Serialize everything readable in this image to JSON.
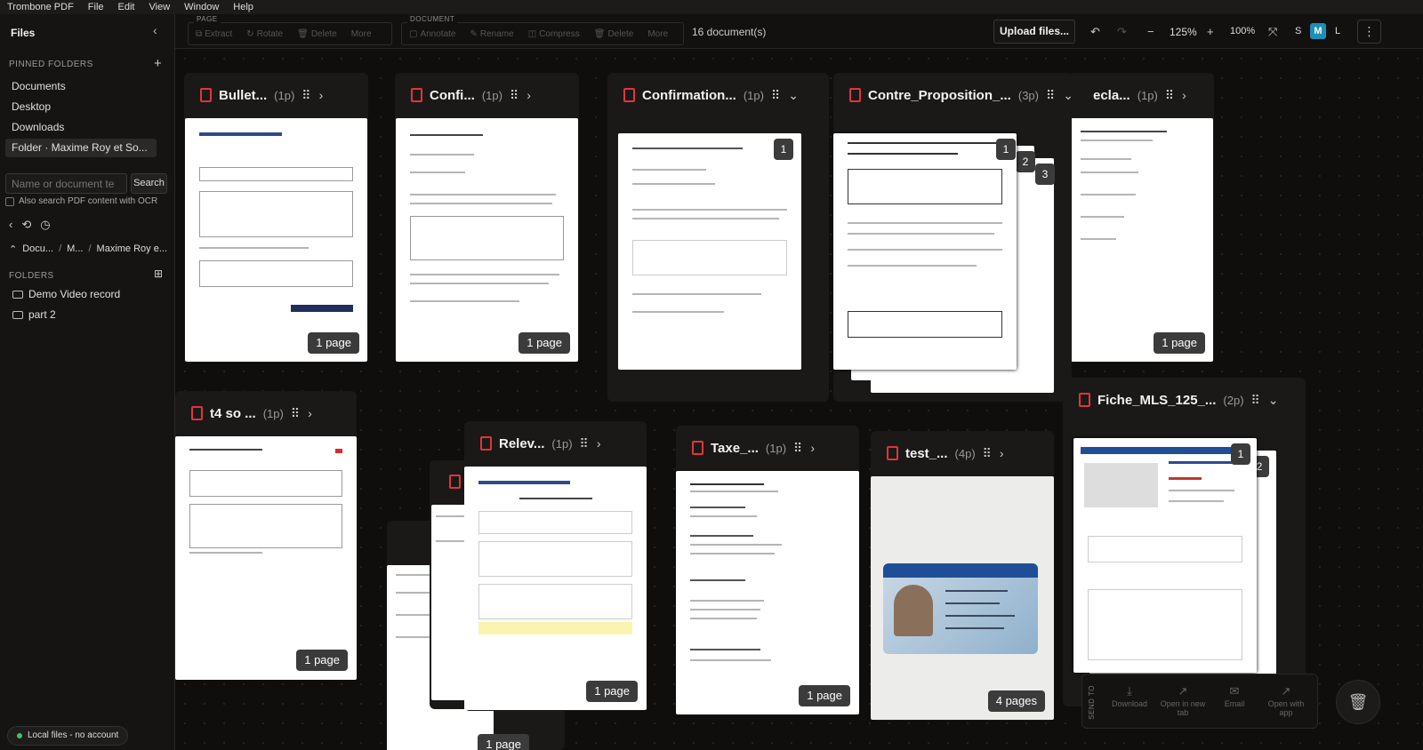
{
  "menubar": {
    "app": "Trombone PDF",
    "items": [
      "File",
      "Edit",
      "View",
      "Window",
      "Help"
    ]
  },
  "sidebar": {
    "title": "Files",
    "pinned_label": "PINNED FOLDERS",
    "pinned": [
      "Documents",
      "Desktop",
      "Downloads",
      "Folder · Maxime Roy et So..."
    ],
    "search_placeholder": "Name or document te",
    "search_button": "Search",
    "ocr_label": "Also search PDF content with OCR",
    "breadcrumb": [
      "Docu...",
      "M...",
      "Maxime Roy e..."
    ],
    "folders_label": "FOLDERS",
    "folders": [
      "Demo Video record",
      "part 2"
    ],
    "status": "Local files - no account"
  },
  "toolbar": {
    "page_group": {
      "label": "PAGE",
      "buttons": [
        "Extract",
        "Rotate",
        "Delete",
        "More"
      ]
    },
    "document_group": {
      "label": "DOCUMENT",
      "buttons": [
        "Annotate",
        "Rename",
        "Compress",
        "Delete",
        "More"
      ]
    },
    "doc_count": "16 document(s)",
    "upload": "Upload files...",
    "zoom": "125%",
    "fit": "100%",
    "sizes": [
      "S",
      "M",
      "L"
    ]
  },
  "cards": [
    {
      "name": "Bullet...",
      "pages": "(1p)",
      "badge": "1 page"
    },
    {
      "name": "Confi...",
      "pages": "(1p)",
      "badge": "1 page"
    },
    {
      "name": "Confirmation...",
      "pages": "(1p)",
      "num": "1"
    },
    {
      "name": "Contre_Proposition_...",
      "pages": "(3p)",
      "nums": [
        "1",
        "2",
        "3"
      ]
    },
    {
      "name": "ecla...",
      "pages": "(1p)",
      "badge": "1 page"
    },
    {
      "name": "t4 so ...",
      "pages": "(1p)",
      "badge": "1 page"
    },
    {
      "name": "Relev...",
      "pages": "(1p)",
      "badge": "1 page"
    },
    {
      "name": "Taxe_...",
      "pages": "(1p)",
      "badge": "1 page"
    },
    {
      "name": "test_...",
      "pages": "(4p)",
      "badge": "4 pages"
    },
    {
      "name": "Fiche_MLS_125_...",
      "pages": "(2p)",
      "nums": [
        "1",
        "2"
      ]
    },
    {
      "badge": "1 page"
    }
  ],
  "send": {
    "label": "SEND TO",
    "items": [
      "Download",
      "Open in new tab",
      "Email",
      "Open with app"
    ]
  }
}
